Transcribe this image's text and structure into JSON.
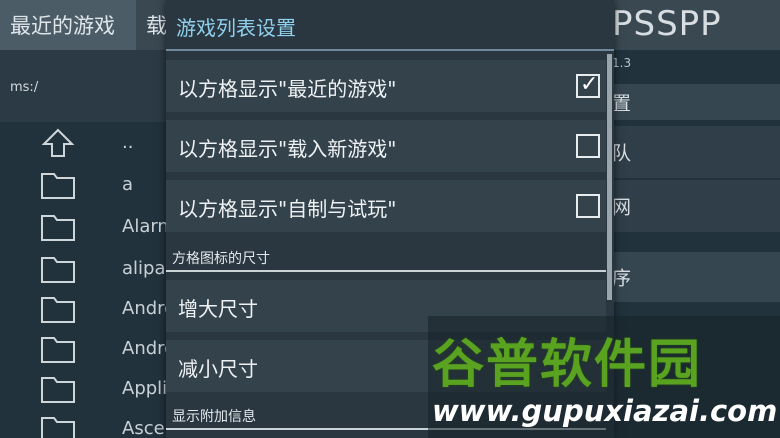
{
  "background_app": {
    "tabs": [
      {
        "label": "最近的游戏"
      },
      {
        "label": "载"
      }
    ],
    "logo": "PSSPP",
    "version": "1.3",
    "path": "ms:/",
    "files": [
      {
        "name": "..",
        "icon": "up-arrow-icon"
      },
      {
        "name": "a",
        "icon": "folder-icon"
      },
      {
        "name": "Alarn",
        "icon": "folder-icon"
      },
      {
        "name": "alipa",
        "icon": "folder-icon"
      },
      {
        "name": "Andro",
        "icon": "folder-icon"
      },
      {
        "name": "Andro",
        "icon": "folder-icon"
      },
      {
        "name": "Appli",
        "icon": "folder-icon"
      },
      {
        "name": "Asce",
        "icon": "folder-icon"
      }
    ],
    "side_menu": [
      {
        "label": "置"
      },
      {
        "label": "队"
      },
      {
        "label": "网"
      },
      {
        "label": "序"
      }
    ]
  },
  "dialog": {
    "title": "游戏列表设置",
    "options": [
      {
        "label": "以方格显示\"最近的游戏\"",
        "checked": true
      },
      {
        "label": "以方格显示\"载入新游戏\"",
        "checked": false
      },
      {
        "label": "以方格显示\"自制与试玩\"",
        "checked": false
      }
    ],
    "section_grid_size": "方格图标的尺寸",
    "increase_label": "增大尺寸",
    "decrease_label": "减小尺寸",
    "section_extra_info": "显示附加信息"
  },
  "watermark": {
    "title": "谷普软件园",
    "url": "www.gupuxiazai.com"
  },
  "colors": {
    "dialog_title": "#8fd0ec",
    "watermark_green": "#5aa321"
  }
}
